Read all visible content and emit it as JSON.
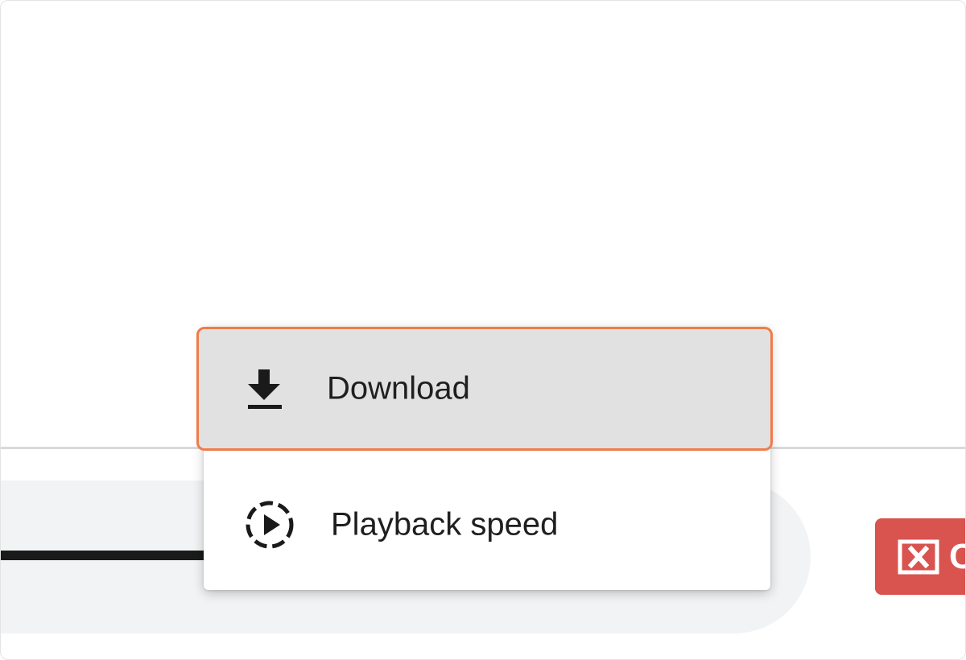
{
  "menu": {
    "items": [
      {
        "label": "Download",
        "icon": "download-icon"
      },
      {
        "label": "Playback speed",
        "icon": "playback-speed-icon"
      }
    ]
  },
  "player": {
    "close_button": {
      "label": "C",
      "icon": "close-box-icon"
    }
  },
  "colors": {
    "highlight_border": "#f07c4a",
    "highlight_bg": "#e1e1e1",
    "close_button_bg": "#d9534f",
    "player_bar_bg": "#f1f3f4"
  }
}
